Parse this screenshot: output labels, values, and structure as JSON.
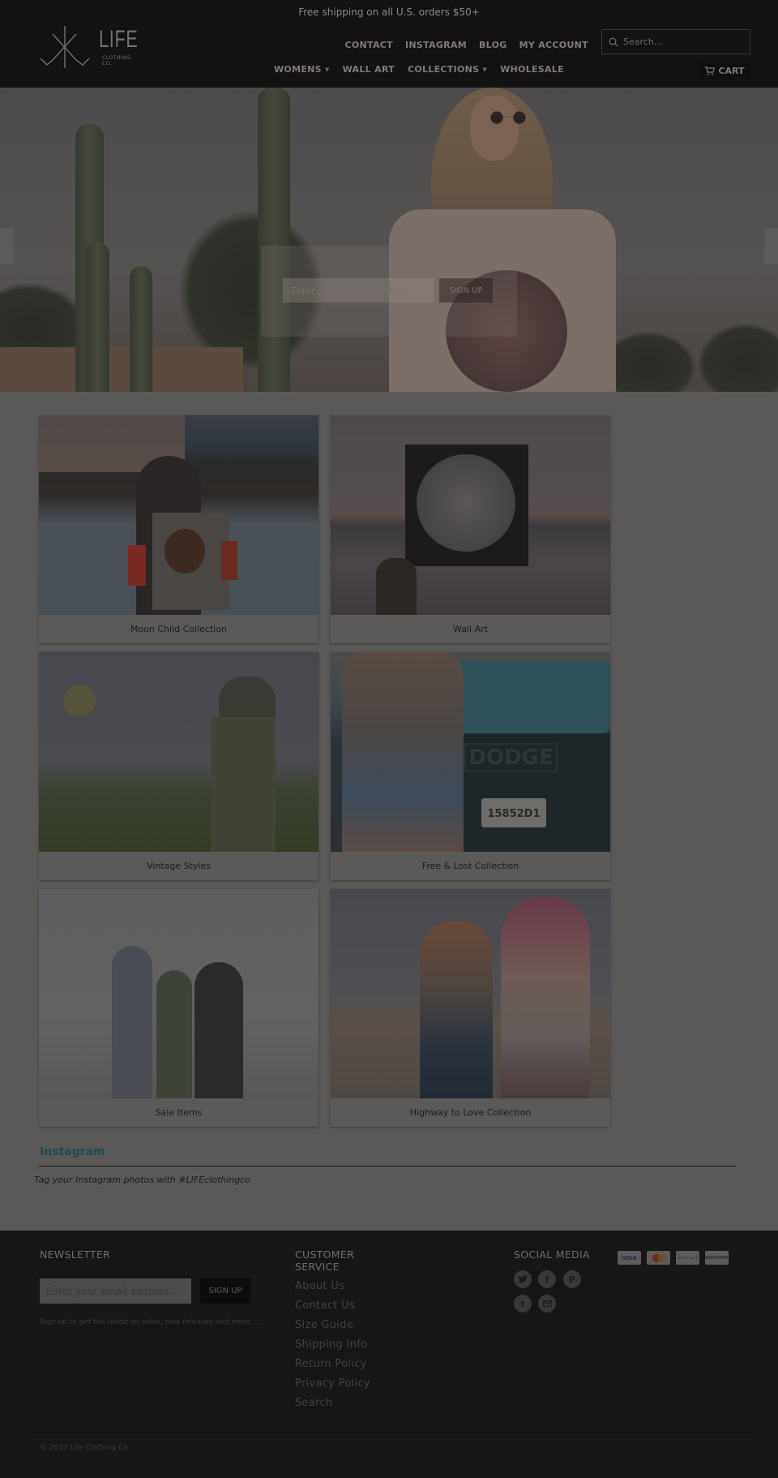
{
  "header": {
    "announcement": "Free shipping on all U.S. orders $50+",
    "logo": {
      "name": "LIFE",
      "subtitle": "CLOTHING CO."
    },
    "top_nav": [
      "CONTACT",
      "INSTAGRAM",
      "BLOG",
      "MY ACCOUNT"
    ],
    "search": {
      "placeholder": "Search...",
      "value": ""
    },
    "main_nav": [
      {
        "label": "WOMENS",
        "dropdown": true
      },
      {
        "label": "WALL ART",
        "dropdown": false
      },
      {
        "label": "COLLECTIONS",
        "dropdown": true
      },
      {
        "label": "WHOLESALE",
        "dropdown": false
      }
    ],
    "cart_label": "CART"
  },
  "hero": {
    "email_placeholder": "Enter your email address...",
    "signup_label": "SIGN UP",
    "prev_arrow": "previous-slide",
    "next_arrow": "next-slide"
  },
  "collections": [
    {
      "label": "Moon Child Collection",
      "image": "woman in desert at dusk wearing graphic tee"
    },
    {
      "label": "Wall Art",
      "image": "hand holding moon wave print on beach"
    },
    {
      "label": "Vintage Styles",
      "image": "woman in olive dress in field"
    },
    {
      "label": "Free & Lost Collection",
      "image": "woman in band tee by Dodge truck"
    },
    {
      "label": "Sale Items",
      "image": "three women cheering outdoors"
    },
    {
      "label": "Highway to Love Collection",
      "image": "two women on desert road"
    }
  ],
  "instagram": {
    "title": "Instagram",
    "tagline": "Tag your Instagram photos with #LIFEclothingco"
  },
  "footer": {
    "newsletter": {
      "heading": "NEWSLETTER",
      "email_placeholder": "Enter your email address...",
      "signup_label": "SIGN UP",
      "note": "Sign up to get the latest on sales, new releases and more ..."
    },
    "customer_service": {
      "heading_line1": "CUSTOMER",
      "heading_line2": "SERVICE",
      "links": [
        "About Us",
        "Contact Us",
        "Size Guide",
        "Shipping Info",
        "Return Policy",
        "Privacy Policy",
        "Search"
      ]
    },
    "social": {
      "heading": "SOCIAL MEDIA",
      "icons": [
        "twitter-icon",
        "facebook-icon",
        "pinterest-icon",
        "tumblr-icon",
        "email-icon"
      ]
    },
    "payments": [
      "VISA",
      "MasterCard",
      "American Express",
      "DISCOVER"
    ],
    "copyright": "© 2017 Life Clothing Co"
  },
  "colors": {
    "header_bg": "#141111",
    "page_bg": "#5a5958",
    "footer_bg": "#171515",
    "instagram_accent": "#234a55"
  }
}
